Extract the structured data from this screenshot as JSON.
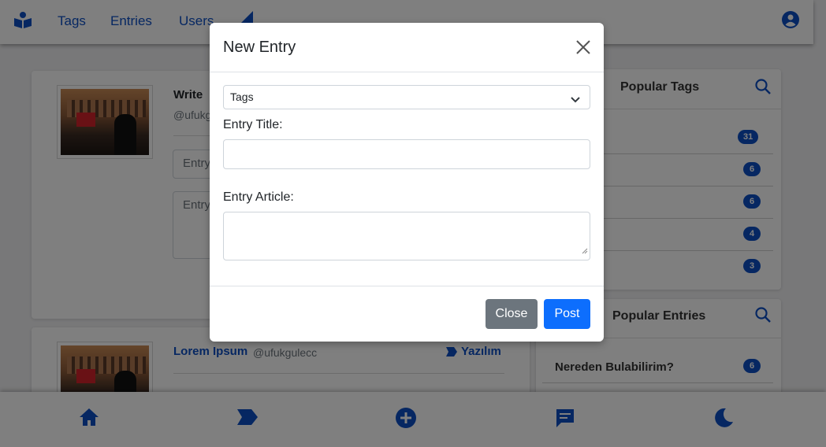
{
  "nav": {
    "links": [
      "Tags",
      "Entries",
      "Users"
    ]
  },
  "composer": {
    "title": "Write",
    "handle": "@ufukg",
    "entry_title_placeholder": "Entry",
    "entry_article_placeholder": "Entry"
  },
  "post": {
    "title": "Lorem Ipsum",
    "handle": "@ufukgulecc",
    "tag": "Yazılım"
  },
  "popular_tags": {
    "title": "Popular Tags",
    "counts": [
      "31",
      "6",
      "6",
      "4",
      "3"
    ]
  },
  "popular_entries": {
    "title": "Popular Entries",
    "items": [
      {
        "label": "Nereden Bulabilirim?",
        "count": "6"
      }
    ]
  },
  "modal": {
    "title": "New Entry",
    "select_value": "Tags",
    "entry_title_label": "Entry Title:",
    "entry_article_label": "Entry Article:",
    "close_label": "Close",
    "post_label": "Post"
  },
  "colors": {
    "primary": "#0d4fc4",
    "post_button": "#0d6efd",
    "close_button": "#6c757d"
  }
}
